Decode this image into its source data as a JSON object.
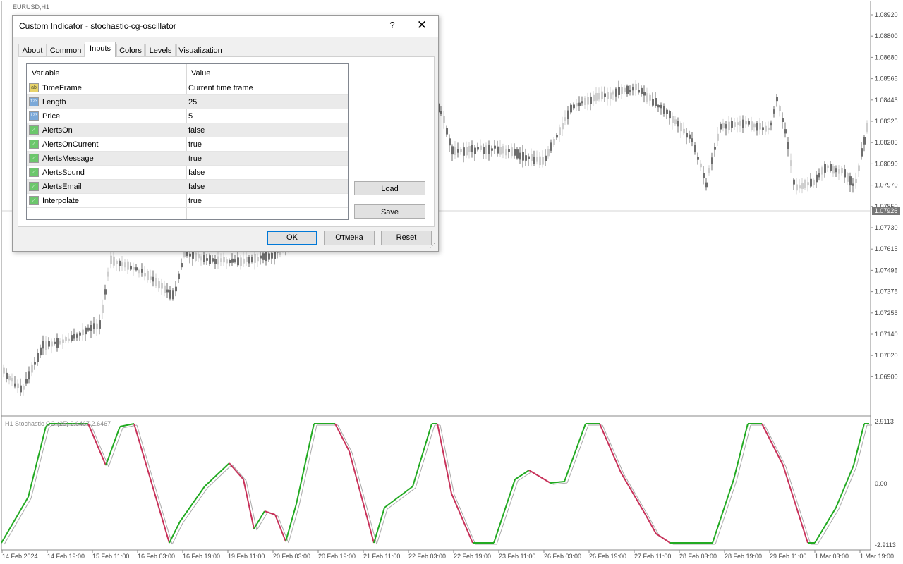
{
  "chart": {
    "symbol": "EURUSD,H1",
    "current_price": "1.07926",
    "price_axis": [
      "1.08920",
      "1.08800",
      "1.08680",
      "1.08565",
      "1.08445",
      "1.08325",
      "1.08205",
      "1.08090",
      "1.07970",
      "1.07850",
      "1.07730",
      "1.07615",
      "1.07495",
      "1.07375",
      "1.07255",
      "1.07140",
      "1.07020",
      "1.06900"
    ],
    "time_axis": [
      "14 Feb 2024",
      "14 Feb 19:00",
      "15 Feb 11:00",
      "16 Feb 03:00",
      "16 Feb 19:00",
      "19 Feb 11:00",
      "20 Feb 03:00",
      "20 Feb 19:00",
      "21 Feb 11:00",
      "22 Feb 03:00",
      "22 Feb 19:00",
      "23 Feb 11:00",
      "26 Feb 03:00",
      "26 Feb 19:00",
      "27 Feb 11:00",
      "28 Feb 03:00",
      "28 Feb 19:00",
      "29 Feb 11:00",
      "1 Mar 03:00",
      "1 Mar 19:00"
    ],
    "indicator_label": "H1 Stochastic CG (25) 2.6467 2.6467",
    "indicator_axis": [
      "2.9113",
      "0.00",
      "-2.9113"
    ],
    "colors": {
      "up": "#22aa22",
      "down": "#c8325a",
      "signal": "#aaaaaa",
      "candle": "#666666"
    }
  },
  "dialog": {
    "title": "Custom Indicator - stochastic-cg-oscillator",
    "help_label": "?",
    "close_label": "✕",
    "tabs": [
      "About",
      "Common",
      "Inputs",
      "Colors",
      "Levels",
      "Visualization"
    ],
    "active_tab": "Inputs",
    "grid_header": {
      "variable": "Variable",
      "value": "Value"
    },
    "rows": [
      {
        "type": "ab",
        "name": "TimeFrame",
        "value": "Current time frame"
      },
      {
        "type": "num",
        "name": "Length",
        "value": "25"
      },
      {
        "type": "num",
        "name": "Price",
        "value": "5"
      },
      {
        "type": "bool",
        "name": "AlertsOn",
        "value": "false"
      },
      {
        "type": "bool",
        "name": "AlertsOnCurrent",
        "value": "true"
      },
      {
        "type": "bool",
        "name": "AlertsMessage",
        "value": "true"
      },
      {
        "type": "bool",
        "name": "AlertsSound",
        "value": "false"
      },
      {
        "type": "bool",
        "name": "AlertsEmail",
        "value": "false"
      },
      {
        "type": "bool",
        "name": "Interpolate",
        "value": "true"
      }
    ],
    "load_label": "Load",
    "save_label": "Save",
    "ok_label": "OK",
    "cancel_label": "Отмена",
    "reset_label": "Reset"
  }
}
